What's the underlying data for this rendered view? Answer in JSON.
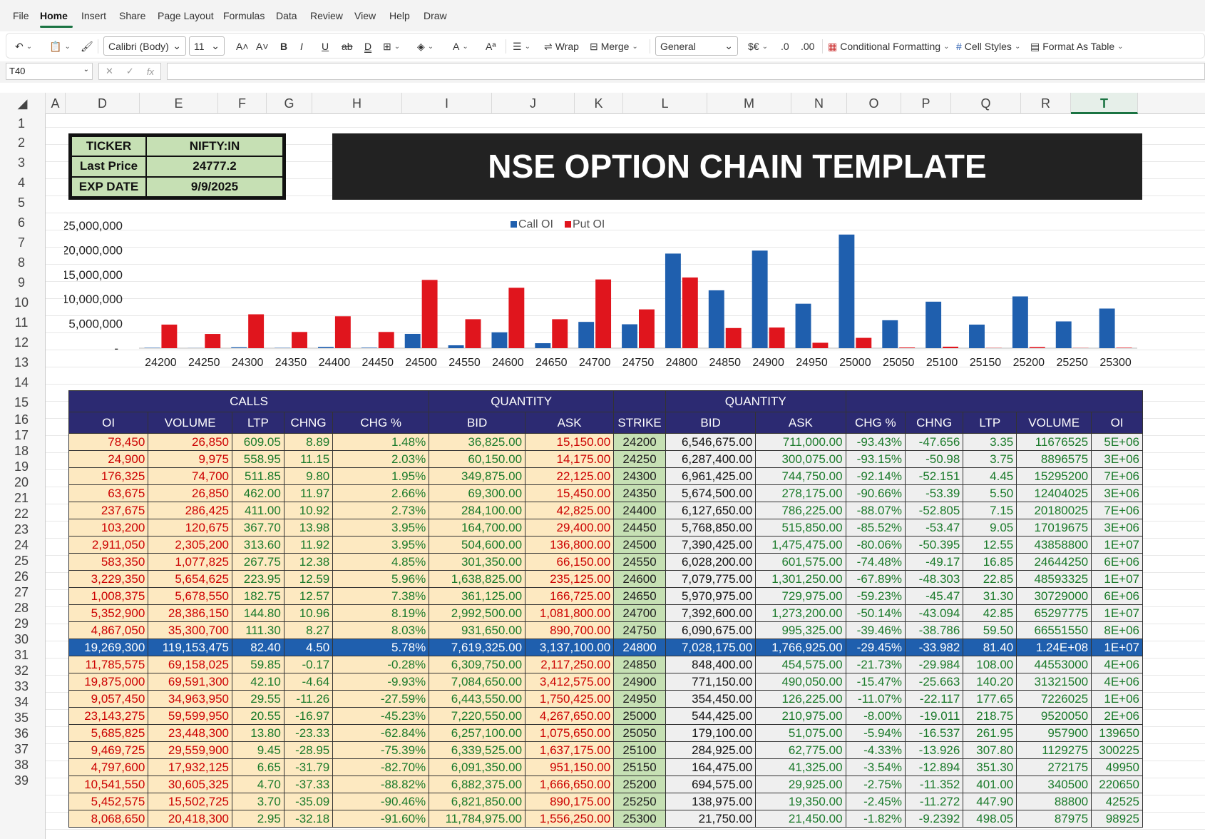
{
  "menu": [
    "File",
    "Home",
    "Insert",
    "Share",
    "Page Layout",
    "Formulas",
    "Data",
    "Review",
    "View",
    "Help",
    "Draw"
  ],
  "ribbon": {
    "font": "Calibri (Body)",
    "size": "11",
    "wrap": "Wrap",
    "merge": "Merge",
    "format": "General",
    "cond": "Conditional Formatting",
    "cellstyles": "Cell Styles",
    "fat": "Format As Table"
  },
  "namebox": "T40",
  "columns": [
    "A",
    "D",
    "E",
    "F",
    "G",
    "H",
    "I",
    "J",
    "K",
    "L",
    "M",
    "N",
    "O",
    "P",
    "Q",
    "R",
    "T"
  ],
  "rows": [
    "1",
    "2",
    "3",
    "4",
    "5",
    "6",
    "7",
    "8",
    "9",
    "10",
    "11",
    "12",
    "13",
    "14",
    "15",
    "16",
    "17",
    "18",
    "19",
    "20",
    "21",
    "22",
    "23",
    "24",
    "25",
    "26",
    "27",
    "28",
    "29",
    "30",
    "31",
    "32",
    "33",
    "34",
    "35",
    "36",
    "37",
    "38",
    "39"
  ],
  "info": {
    "ticker_label": "TICKER",
    "ticker": "NIFTY:IN",
    "price_label": "Last Price",
    "price": "24777.2",
    "exp_label": "EXP DATE",
    "exp": "9/9/2025"
  },
  "title": "NSE OPTION CHAIN TEMPLATE",
  "colors": {
    "call": "#1f5fae",
    "put": "#e0151d",
    "header": "#2c2a72"
  },
  "chart_data": {
    "type": "bar",
    "categories": [
      "24200",
      "24250",
      "24300",
      "24350",
      "24400",
      "24450",
      "24500",
      "24550",
      "24600",
      "24650",
      "24700",
      "24750",
      "24800",
      "24850",
      "24900",
      "24950",
      "25000",
      "25050",
      "25100",
      "25150",
      "25200",
      "25250",
      "25300"
    ],
    "series": [
      {
        "name": "Call OI",
        "values": [
          78450,
          24900,
          176325,
          63675,
          237675,
          103200,
          2911050,
          583350,
          3229350,
          1008375,
          5352900,
          4867050,
          19269300,
          11785575,
          19875000,
          9057450,
          23143275,
          5685825,
          9469725,
          4797600,
          10541550,
          5452575,
          8068650
        ]
      },
      {
        "name": "Put OI",
        "values": [
          4800000,
          2900000,
          6900000,
          3300000,
          6500000,
          3300000,
          13900000,
          5900000,
          12300000,
          5900000,
          14000000,
          7900000,
          14400000,
          4100000,
          4200000,
          1100000,
          2100000,
          139650,
          300225,
          49950,
          220650,
          42525,
          98925
        ]
      }
    ],
    "yticks": [
      "25,000,000",
      "20,000,000",
      "15,000,000",
      "10,000,000",
      "5,000,000",
      "-"
    ],
    "ylim": [
      0,
      25000000
    ],
    "legend": "top-center"
  },
  "table": {
    "group_calls": "CALLS",
    "group_qty": "QUANTITY",
    "group_qty2": "QUANTITY",
    "headers": [
      "OI",
      "VOLUME",
      "LTP",
      "CHNG",
      "CHG %",
      "BID",
      "ASK",
      "STRIKE",
      "BID",
      "ASK",
      "CHG %",
      "CHNG",
      "LTP",
      "VOLUME",
      "OI"
    ],
    "rows": [
      [
        "78,450",
        "26,850",
        "609.05",
        "8.89",
        "1.48%",
        "36,825.00",
        "15,150.00",
        "24200",
        "6,546,675.00",
        "711,000.00",
        "-93.43%",
        "-47.656",
        "3.35",
        "11676525",
        "5E+06"
      ],
      [
        "24,900",
        "9,975",
        "558.95",
        "11.15",
        "2.03%",
        "60,150.00",
        "14,175.00",
        "24250",
        "6,287,400.00",
        "300,075.00",
        "-93.15%",
        "-50.98",
        "3.75",
        "8896575",
        "3E+06"
      ],
      [
        "176,325",
        "74,700",
        "511.85",
        "9.80",
        "1.95%",
        "349,875.00",
        "22,125.00",
        "24300",
        "6,961,425.00",
        "744,750.00",
        "-92.14%",
        "-52.151",
        "4.45",
        "15295200",
        "7E+06"
      ],
      [
        "63,675",
        "26,850",
        "462.00",
        "11.97",
        "2.66%",
        "69,300.00",
        "15,450.00",
        "24350",
        "5,674,500.00",
        "278,175.00",
        "-90.66%",
        "-53.39",
        "5.50",
        "12404025",
        "3E+06"
      ],
      [
        "237,675",
        "286,425",
        "411.00",
        "10.92",
        "2.73%",
        "284,100.00",
        "42,825.00",
        "24400",
        "6,127,650.00",
        "786,225.00",
        "-88.07%",
        "-52.805",
        "7.15",
        "20180025",
        "7E+06"
      ],
      [
        "103,200",
        "120,675",
        "367.70",
        "13.98",
        "3.95%",
        "164,700.00",
        "29,400.00",
        "24450",
        "5,768,850.00",
        "515,850.00",
        "-85.52%",
        "-53.47",
        "9.05",
        "17019675",
        "3E+06"
      ],
      [
        "2,911,050",
        "2,305,200",
        "313.60",
        "11.92",
        "3.95%",
        "504,600.00",
        "136,800.00",
        "24500",
        "7,390,425.00",
        "1,475,475.00",
        "-80.06%",
        "-50.395",
        "12.55",
        "43858800",
        "1E+07"
      ],
      [
        "583,350",
        "1,077,825",
        "267.75",
        "12.38",
        "4.85%",
        "301,350.00",
        "66,150.00",
        "24550",
        "6,028,200.00",
        "601,575.00",
        "-74.48%",
        "-49.17",
        "16.85",
        "24644250",
        "6E+06"
      ],
      [
        "3,229,350",
        "5,654,625",
        "223.95",
        "12.59",
        "5.96%",
        "1,638,825.00",
        "235,125.00",
        "24600",
        "7,079,775.00",
        "1,301,250.00",
        "-67.89%",
        "-48.303",
        "22.85",
        "48593325",
        "1E+07"
      ],
      [
        "1,008,375",
        "5,678,550",
        "182.75",
        "12.57",
        "7.38%",
        "361,125.00",
        "166,725.00",
        "24650",
        "5,970,975.00",
        "729,975.00",
        "-59.23%",
        "-45.47",
        "31.30",
        "30729000",
        "6E+06"
      ],
      [
        "5,352,900",
        "28,386,150",
        "144.80",
        "10.96",
        "8.19%",
        "2,992,500.00",
        "1,081,800.00",
        "24700",
        "7,392,600.00",
        "1,273,200.00",
        "-50.14%",
        "-43.094",
        "42.85",
        "65297775",
        "1E+07"
      ],
      [
        "4,867,050",
        "35,300,700",
        "111.30",
        "8.27",
        "8.03%",
        "931,650.00",
        "890,700.00",
        "24750",
        "6,090,675.00",
        "995,325.00",
        "-39.46%",
        "-38.786",
        "59.50",
        "66551550",
        "8E+06"
      ],
      [
        "19,269,300",
        "119,153,475",
        "82.40",
        "4.50",
        "5.78%",
        "7,619,325.00",
        "3,137,100.00",
        "24800",
        "7,028,175.00",
        "1,766,925.00",
        "-29.45%",
        "-33.982",
        "81.40",
        "1.24E+08",
        "1E+07"
      ],
      [
        "11,785,575",
        "69,158,025",
        "59.85",
        "-0.17",
        "-0.28%",
        "6,309,750.00",
        "2,117,250.00",
        "24850",
        "848,400.00",
        "454,575.00",
        "-21.73%",
        "-29.984",
        "108.00",
        "44553000",
        "4E+06"
      ],
      [
        "19,875,000",
        "69,591,300",
        "42.10",
        "-4.64",
        "-9.93%",
        "7,084,650.00",
        "3,412,575.00",
        "24900",
        "771,150.00",
        "490,050.00",
        "-15.47%",
        "-25.663",
        "140.20",
        "31321500",
        "4E+06"
      ],
      [
        "9,057,450",
        "34,963,950",
        "29.55",
        "-11.26",
        "-27.59%",
        "6,443,550.00",
        "1,750,425.00",
        "24950",
        "354,450.00",
        "126,225.00",
        "-11.07%",
        "-22.117",
        "177.65",
        "7226025",
        "1E+06"
      ],
      [
        "23,143,275",
        "59,599,950",
        "20.55",
        "-16.97",
        "-45.23%",
        "7,220,550.00",
        "4,267,650.00",
        "25000",
        "544,425.00",
        "210,975.00",
        "-8.00%",
        "-19.011",
        "218.75",
        "9520050",
        "2E+06"
      ],
      [
        "5,685,825",
        "23,448,300",
        "13.80",
        "-23.33",
        "-62.84%",
        "6,257,100.00",
        "1,075,650.00",
        "25050",
        "179,100.00",
        "51,075.00",
        "-5.94%",
        "-16.537",
        "261.95",
        "957900",
        "139650"
      ],
      [
        "9,469,725",
        "29,559,900",
        "9.45",
        "-28.95",
        "-75.39%",
        "6,339,525.00",
        "1,637,175.00",
        "25100",
        "284,925.00",
        "62,775.00",
        "-4.33%",
        "-13.926",
        "307.80",
        "1129275",
        "300225"
      ],
      [
        "4,797,600",
        "17,932,125",
        "6.65",
        "-31.79",
        "-82.70%",
        "6,091,350.00",
        "951,150.00",
        "25150",
        "164,475.00",
        "41,325.00",
        "-3.54%",
        "-12.894",
        "351.30",
        "272175",
        "49950"
      ],
      [
        "10,541,550",
        "30,605,325",
        "4.70",
        "-37.33",
        "-88.82%",
        "6,882,375.00",
        "1,666,650.00",
        "25200",
        "694,575.00",
        "29,925.00",
        "-2.75%",
        "-11.352",
        "401.00",
        "340500",
        "220650"
      ],
      [
        "5,452,575",
        "15,502,725",
        "3.70",
        "-35.09",
        "-90.46%",
        "6,821,850.00",
        "890,175.00",
        "25250",
        "138,975.00",
        "19,350.00",
        "-2.45%",
        "-11.272",
        "447.90",
        "88800",
        "42525"
      ],
      [
        "8,068,650",
        "20,418,300",
        "2.95",
        "-32.18",
        "-91.60%",
        "11,784,975.00",
        "1,556,250.00",
        "25300",
        "21,750.00",
        "21,450.00",
        "-1.82%",
        "-9.2392",
        "498.05",
        "87975",
        "98925"
      ]
    ]
  }
}
